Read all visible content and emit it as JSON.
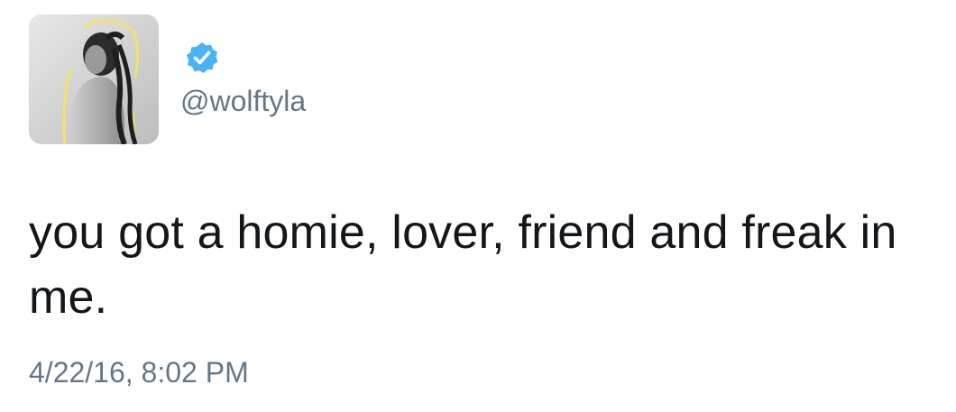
{
  "tweet": {
    "avatar_icon": "profile-photo",
    "verified_icon": "verified-badge-icon",
    "handle": "@wolftyla",
    "text": "you got a homie, lover, friend and freak in me.",
    "timestamp": "4/22/16, 8:02 PM"
  },
  "colors": {
    "verified_badge": "#4ab3f4",
    "text": "#14171a",
    "secondary_text": "#657786",
    "avatar_halo": "#f2e36b"
  }
}
